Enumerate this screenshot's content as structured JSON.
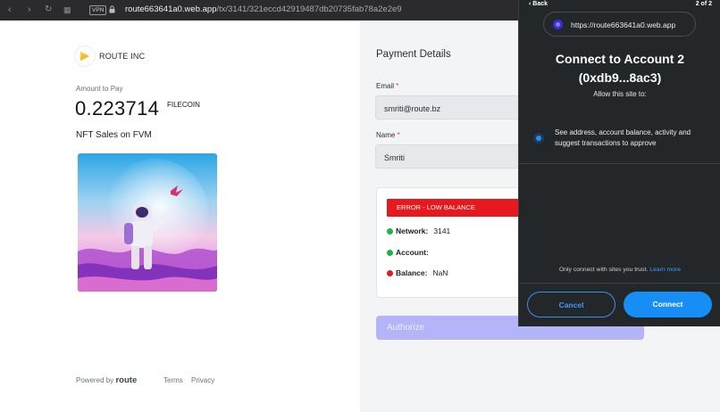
{
  "browser": {
    "vpn_label": "VPN",
    "url_host": "route663641a0.web.app",
    "url_path": "/tx/3141/321eccd42919487db20735fab78a2e2e9"
  },
  "checkout": {
    "company": "ROUTE INC",
    "amount_label": "Amount to Pay",
    "amount": "0.223714",
    "currency": "FILECOIN",
    "product": "NFT Sales on FVM",
    "footer": {
      "powered_by": "Powered by",
      "brand": "route",
      "terms": "Terms",
      "privacy": "Privacy"
    }
  },
  "payment": {
    "title": "Payment Details",
    "email_label": "Email",
    "email_value": "smriti@route.bz",
    "name_label": "Name",
    "name_value": "Smriti",
    "required_mark": "*",
    "error_banner": "ERROR - LOW BALANCE",
    "status": [
      {
        "key": "Network:",
        "value": "3141",
        "color": "#22b24c"
      },
      {
        "key": "Account:",
        "value": "",
        "color": "#22b24c"
      },
      {
        "key": "Balance:",
        "value": "NaN",
        "color": "#e01e1e"
      }
    ],
    "authorize_label": "Authorize"
  },
  "wallet": {
    "back_label": "Back",
    "page_count": "2 of 2",
    "site": "https://route663641a0.web.app",
    "title_line1": "Connect to Account 2",
    "title_line2": "(0xdb9...8ac3)",
    "subtitle": "Allow this site to:",
    "permission": "See address, account balance, activity and suggest transactions to approve",
    "trust_text": "Only connect with sites you trust.",
    "learn_more": "Learn more",
    "cancel_label": "Cancel",
    "connect_label": "Connect"
  },
  "colors": {
    "accent": "#168ef5",
    "error": "#e8191e",
    "authorize": "#b4b4f8"
  }
}
